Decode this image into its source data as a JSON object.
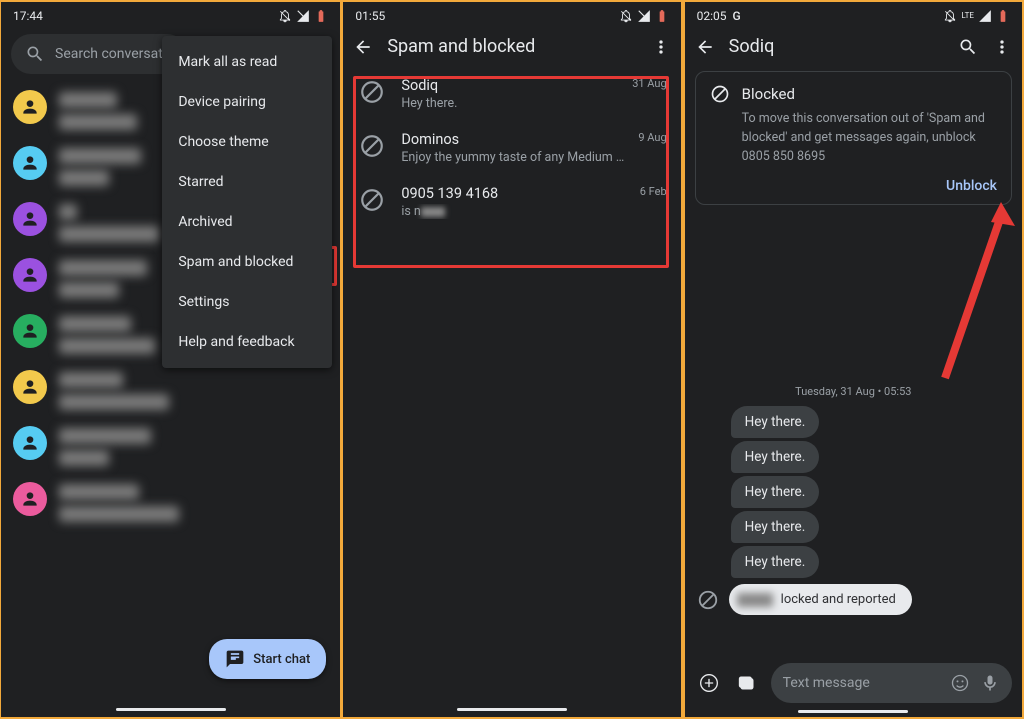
{
  "panel1": {
    "time": "17:44",
    "search_placeholder": "Search conversat",
    "menu": {
      "mark_all": "Mark all as read",
      "device_pairing": "Device pairing",
      "choose_theme": "Choose theme",
      "starred": "Starred",
      "archived": "Archived",
      "spam_blocked": "Spam and blocked",
      "settings": "Settings",
      "help": "Help and feedback"
    },
    "fab_label": "Start chat"
  },
  "panel2": {
    "time": "01:55",
    "title": "Spam and blocked",
    "items": [
      {
        "name": "Sodiq",
        "preview": "Hey there.",
        "date": "31 Aug"
      },
      {
        "name": "Dominos",
        "preview": "Enjoy the yummy taste of any Medium …",
        "date": "9 Aug"
      },
      {
        "name": "0905 139 4168",
        "preview": "is n",
        "date": "6 Feb"
      }
    ]
  },
  "panel3": {
    "time": "02:05",
    "g_label": "G",
    "title": "Sodiq",
    "lte": "LTE",
    "blocked": {
      "heading": "Blocked",
      "body": "To move this conversation out of 'Spam and blocked' and get messages again, unblock 0805 850 8695",
      "unblock": "Unblock"
    },
    "date_separator": "Tuesday, 31 Aug • 05:53",
    "messages": [
      "Hey there.",
      "Hey there.",
      "Hey there.",
      "Hey there.",
      "Hey there."
    ],
    "toast_suffix": "locked and reported",
    "compose_placeholder": "Text message"
  }
}
